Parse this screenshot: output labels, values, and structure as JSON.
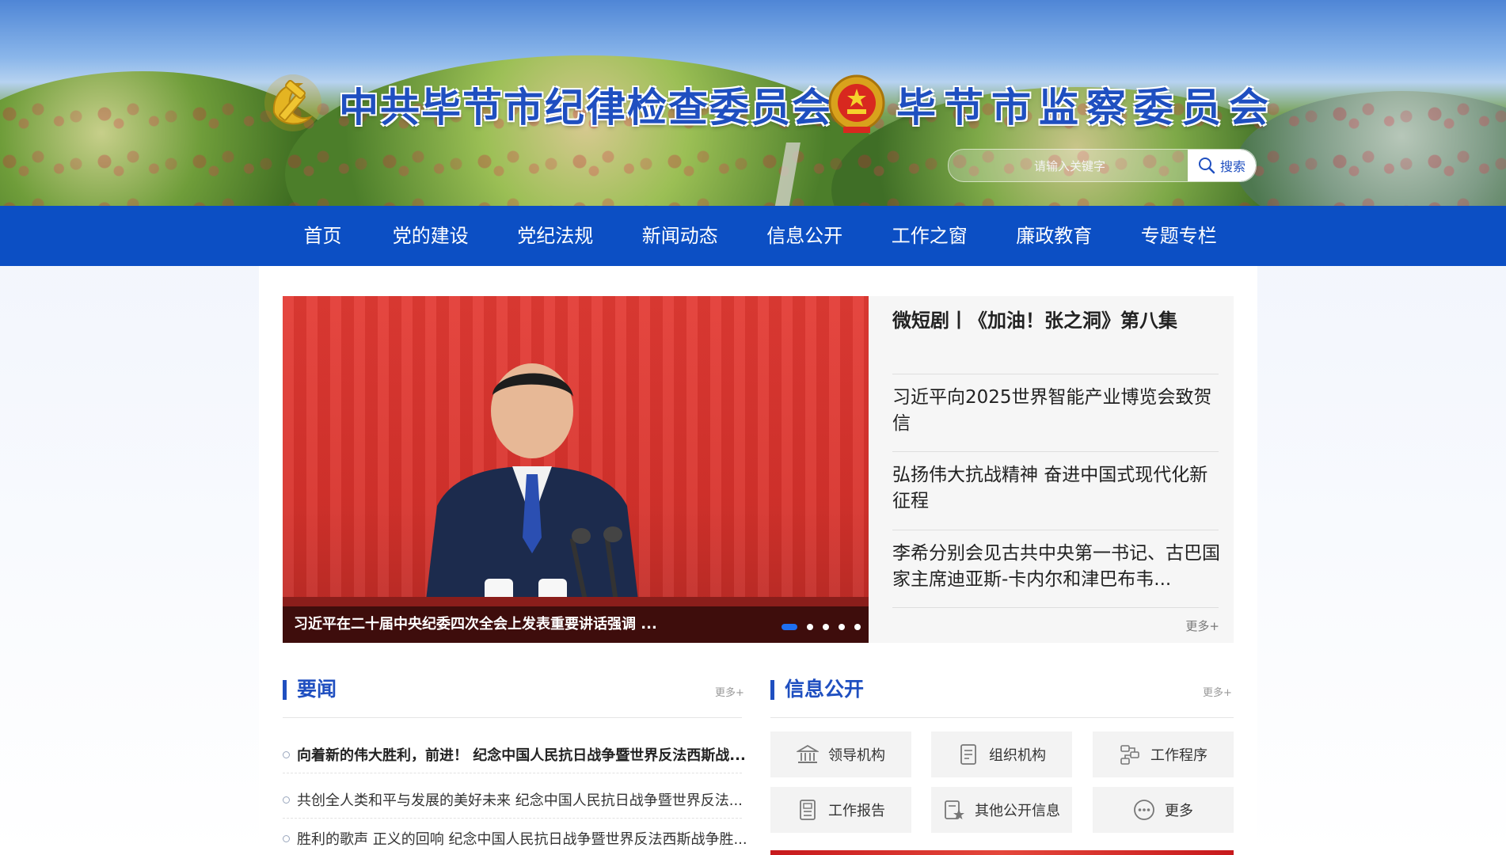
{
  "header": {
    "title_left": "中共毕节市纪律检查委员会",
    "title_right": "毕节市监察委员会",
    "search": {
      "placeholder": "请输入关键字",
      "button_label": "搜索"
    }
  },
  "nav": {
    "items": [
      "首页",
      "党的建设",
      "党纪法规",
      "新闻动态",
      "信息公开",
      "工作之窗",
      "廉政教育",
      "专题专栏"
    ]
  },
  "carousel": {
    "caption": "习近平在二十届中央纪委四次全会上发表重要讲话强调 ...",
    "slide_count": 5,
    "active_slide": 1
  },
  "headlines": {
    "top": "微短剧丨《加油！张之洞》第八集",
    "items": [
      "习近平向2025世界智能产业博览会致贺信",
      "弘扬伟大抗战精神 奋进中国式现代化新征程",
      "李希分别会见古共中央第一书记、古巴国家主席迪亚斯-卡内尔和津巴布韦..."
    ],
    "more": "更多+"
  },
  "news": {
    "title": "要闻",
    "more": "更多+",
    "items": [
      "向着新的伟大胜利，前进！ 纪念中国人民抗日战争暨世界反法西斯战...",
      "共创全人类和平与发展的美好未来 纪念中国人民抗日战争暨世界反法...",
      "胜利的歌声 正义的回响 纪念中国人民抗日战争暨世界反法西斯战争胜..."
    ]
  },
  "info": {
    "title": "信息公开",
    "more": "更多+",
    "cards": [
      {
        "label": "领导机构",
        "icon": "building-icon"
      },
      {
        "label": "组织机构",
        "icon": "document-icon"
      },
      {
        "label": "工作程序",
        "icon": "workflow-icon"
      },
      {
        "label": "工作报告",
        "icon": "report-icon"
      },
      {
        "label": "其他公开信息",
        "icon": "star-document-icon"
      },
      {
        "label": "更多",
        "icon": "more-dots-icon"
      }
    ]
  },
  "colors": {
    "nav_blue": "#0c4fc4",
    "title_blue": "#1f4fc0",
    "carousel_red": "#d8322c",
    "accent_red": "#c7191c"
  }
}
